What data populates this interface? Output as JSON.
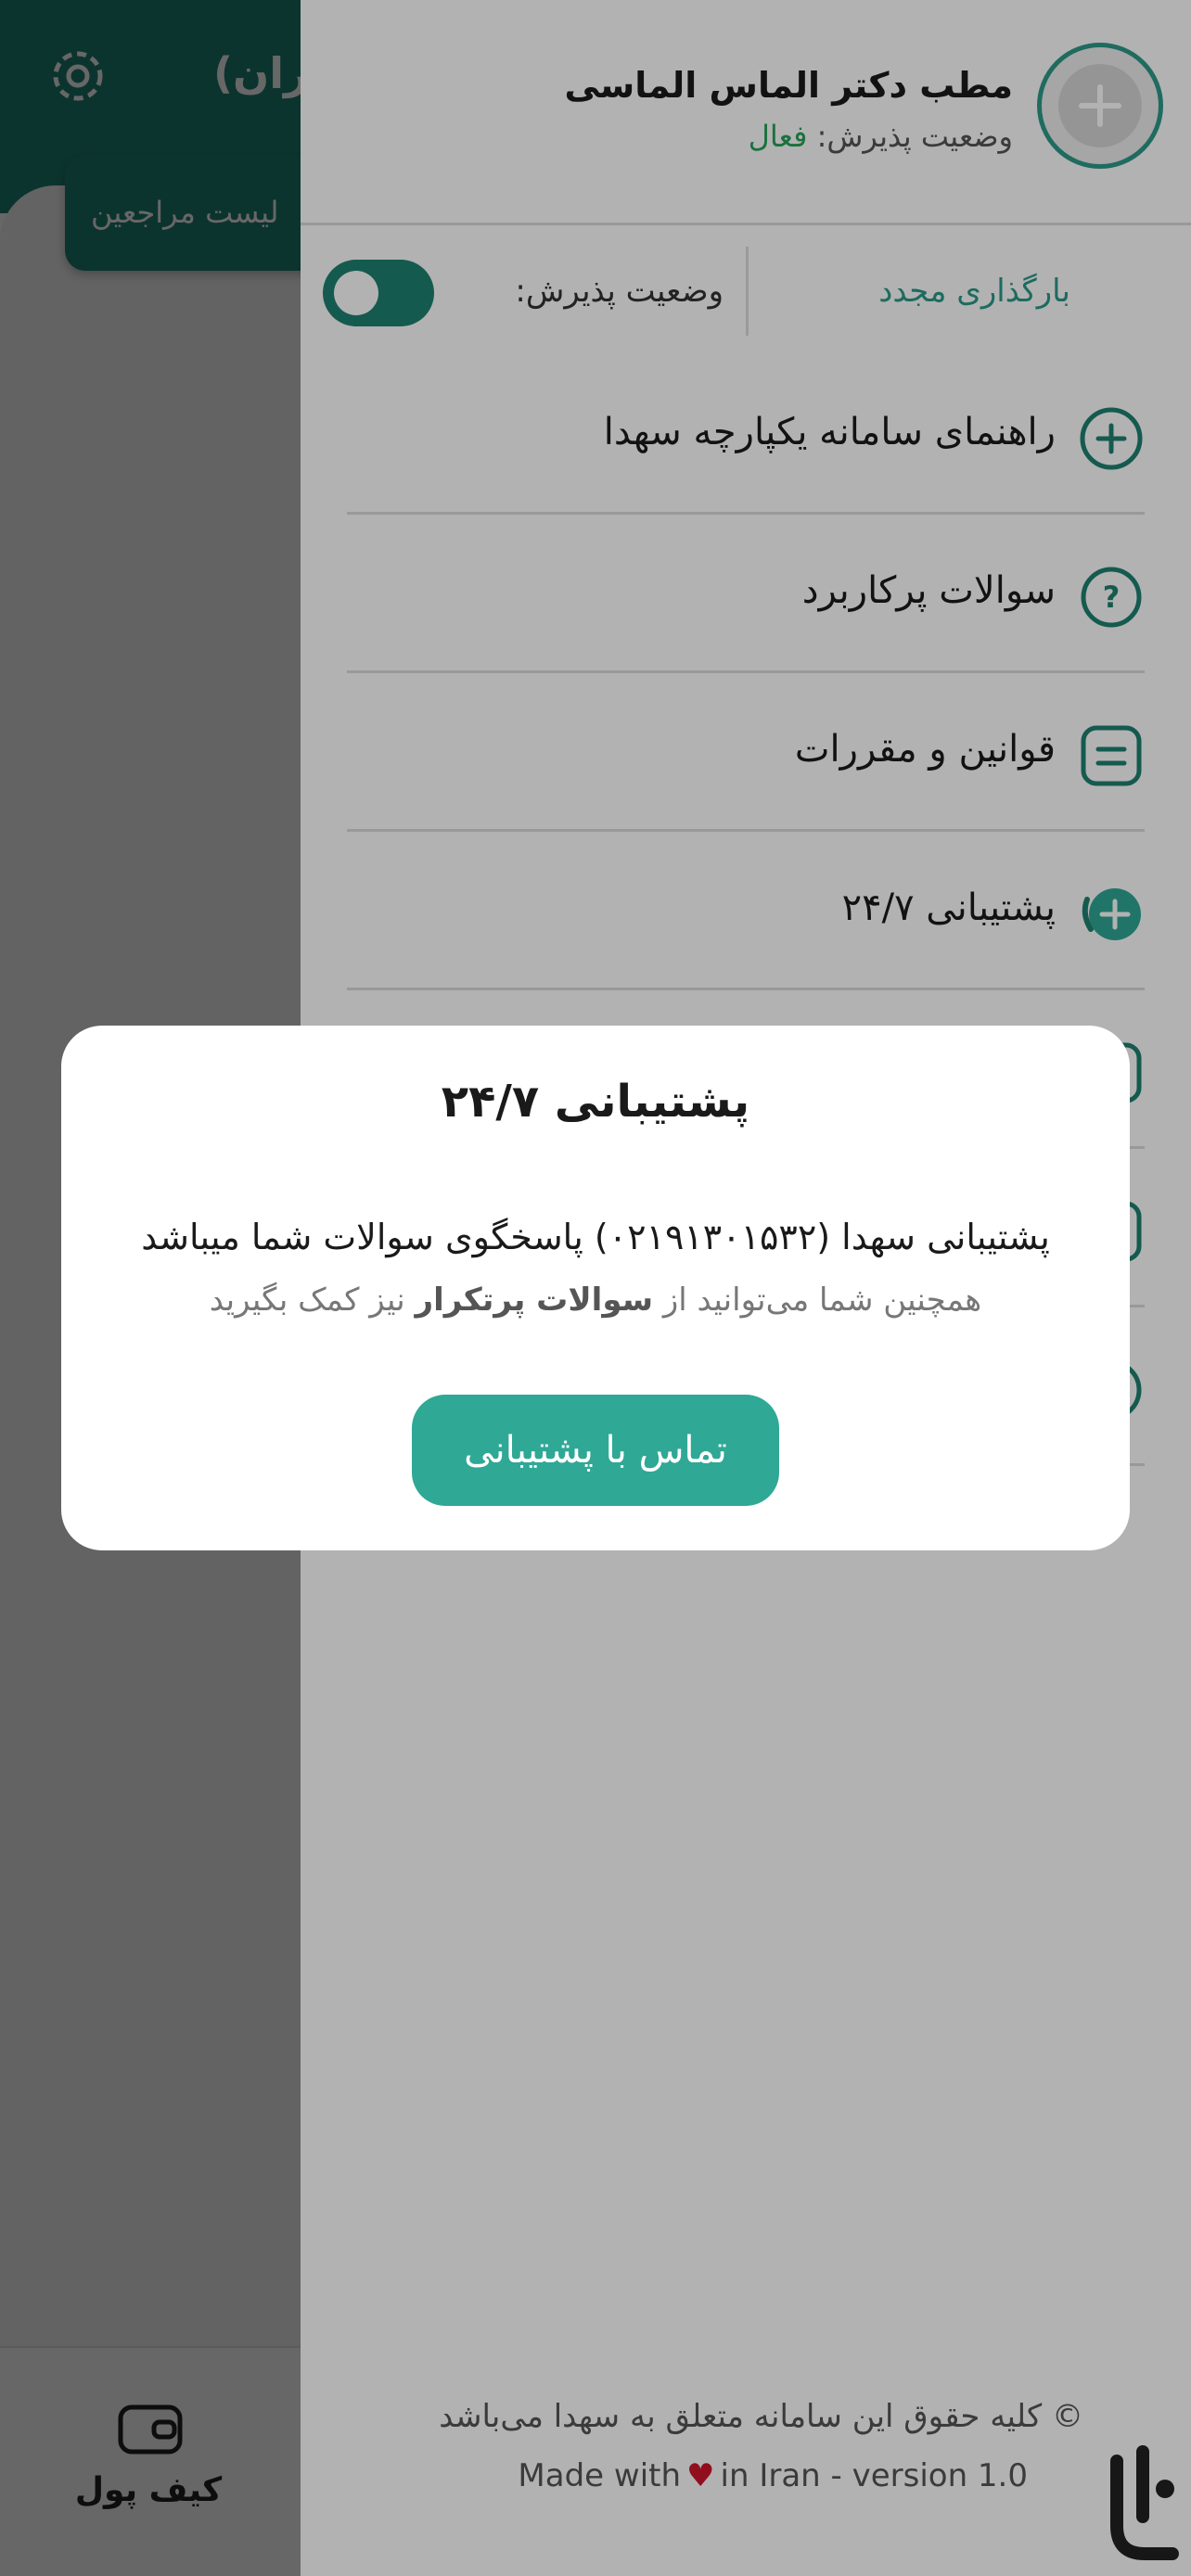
{
  "app": {
    "title": "یران)",
    "patients_button": "لیست مراجعین",
    "bottom_nav": {
      "wallet_label": "کیف پول"
    }
  },
  "drawer": {
    "clinic_name": "مطب دکتر الماس الماسی",
    "status_label": "وضعیت پذیرش: ",
    "status_value": "فعال",
    "reload": "بارگذاری مجدد",
    "acceptance_label": "وضعیت پذیرش:",
    "acceptance_on": false,
    "menu": [
      {
        "label": "راهنمای سامانه یکپارچه سهدا",
        "icon": "plus-circle-icon"
      },
      {
        "label": "سوالات پرکاربرد",
        "icon": "question-circle-icon"
      },
      {
        "label": "قوانین و مقررات",
        "icon": "document-icon"
      },
      {
        "label": "پشتیبانی ۲۴/۷",
        "icon": "support-chat-icon"
      },
      {
        "label": "",
        "icon": "square-icon"
      },
      {
        "label": "",
        "icon": "square-icon"
      },
      {
        "label": "",
        "icon": "circle-icon"
      }
    ],
    "footer": {
      "copyright": "© کلیه حقوق این سامانه متعلق به سهدا می‌باشد",
      "made_prefix": "Made with",
      "made_suffix": "in Iran - version 1.0",
      "heart": "♥"
    }
  },
  "dialog": {
    "title": "پشتیبانی ۲۴/۷",
    "line1": "پشتیبانی سهدا (۰۲۱۹۱۳۰۱۵۳۲) پاسخگوی سوالات شما میباشد",
    "line2_prefix": "همچنین شما می‌توانید از ",
    "line2_link": "سوالات پرتکرار",
    "line2_suffix": " نیز کمک بگیرید",
    "button": "تماس با پشتیبانی"
  },
  "colors": {
    "brand": "#1f8272",
    "accent": "#2fa896",
    "status_active": "#27a35a",
    "heart": "#d0152b"
  }
}
